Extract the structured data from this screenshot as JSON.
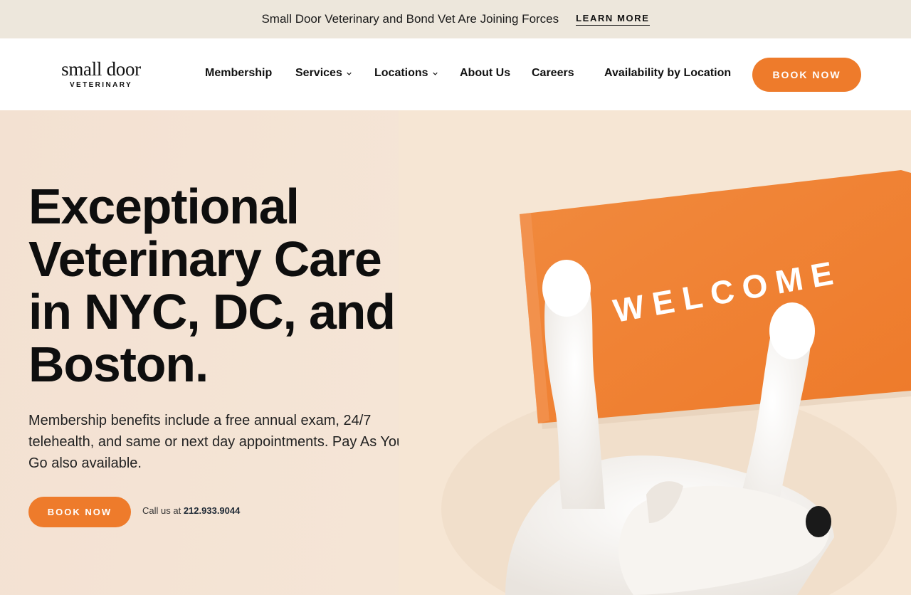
{
  "announcement": {
    "text": "Small Door Veterinary and Bond Vet Are Joining Forces",
    "link": "LEARN MORE"
  },
  "header": {
    "logo_main": "small door",
    "logo_sub": "VETERINARY",
    "nav": [
      {
        "label": "Membership",
        "has_dropdown": false
      },
      {
        "label": "Services",
        "has_dropdown": true
      },
      {
        "label": "Locations",
        "has_dropdown": true
      },
      {
        "label": "About Us",
        "has_dropdown": false
      },
      {
        "label": "Careers",
        "has_dropdown": false
      },
      {
        "label": "Availability by Location",
        "has_dropdown": false
      }
    ],
    "cta": "BOOK NOW"
  },
  "hero": {
    "title_lines": [
      "Exceptional",
      "Veterinary Care",
      "in NYC, DC, and",
      "Boston."
    ],
    "subtitle": "Membership benefits include a free annual exam, 24/7 telehealth, and same or next day appointments. Pay As You Go also available.",
    "cta": "BOOK NOW",
    "call_prefix": "Call us at",
    "phone": "212.933.9044",
    "image": {
      "icon": "dog-on-welcome-mat-photo",
      "mat_text": "WELCOME"
    }
  },
  "colors": {
    "accent": "#ee7b2b",
    "announcement_bg": "#ede7dc",
    "hero_bg": "#f4e3d4",
    "text": "#111111"
  }
}
